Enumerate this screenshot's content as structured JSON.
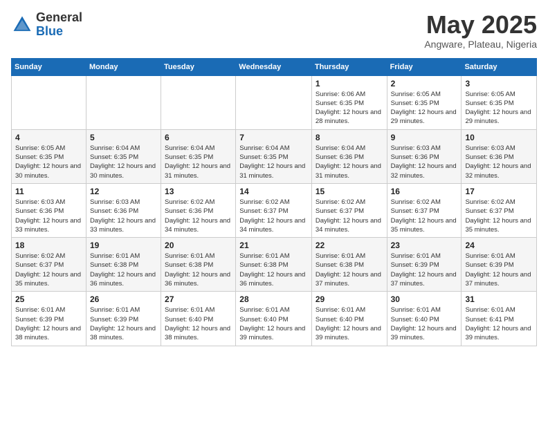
{
  "logo": {
    "general": "General",
    "blue": "Blue"
  },
  "title": "May 2025",
  "location": "Angware, Plateau, Nigeria",
  "headers": [
    "Sunday",
    "Monday",
    "Tuesday",
    "Wednesday",
    "Thursday",
    "Friday",
    "Saturday"
  ],
  "weeks": [
    [
      {
        "day": "",
        "sunrise": "",
        "sunset": "",
        "daylight": ""
      },
      {
        "day": "",
        "sunrise": "",
        "sunset": "",
        "daylight": ""
      },
      {
        "day": "",
        "sunrise": "",
        "sunset": "",
        "daylight": ""
      },
      {
        "day": "",
        "sunrise": "",
        "sunset": "",
        "daylight": ""
      },
      {
        "day": "1",
        "sunrise": "Sunrise: 6:06 AM",
        "sunset": "Sunset: 6:35 PM",
        "daylight": "Daylight: 12 hours and 28 minutes."
      },
      {
        "day": "2",
        "sunrise": "Sunrise: 6:05 AM",
        "sunset": "Sunset: 6:35 PM",
        "daylight": "Daylight: 12 hours and 29 minutes."
      },
      {
        "day": "3",
        "sunrise": "Sunrise: 6:05 AM",
        "sunset": "Sunset: 6:35 PM",
        "daylight": "Daylight: 12 hours and 29 minutes."
      }
    ],
    [
      {
        "day": "4",
        "sunrise": "Sunrise: 6:05 AM",
        "sunset": "Sunset: 6:35 PM",
        "daylight": "Daylight: 12 hours and 30 minutes."
      },
      {
        "day": "5",
        "sunrise": "Sunrise: 6:04 AM",
        "sunset": "Sunset: 6:35 PM",
        "daylight": "Daylight: 12 hours and 30 minutes."
      },
      {
        "day": "6",
        "sunrise": "Sunrise: 6:04 AM",
        "sunset": "Sunset: 6:35 PM",
        "daylight": "Daylight: 12 hours and 31 minutes."
      },
      {
        "day": "7",
        "sunrise": "Sunrise: 6:04 AM",
        "sunset": "Sunset: 6:35 PM",
        "daylight": "Daylight: 12 hours and 31 minutes."
      },
      {
        "day": "8",
        "sunrise": "Sunrise: 6:04 AM",
        "sunset": "Sunset: 6:36 PM",
        "daylight": "Daylight: 12 hours and 31 minutes."
      },
      {
        "day": "9",
        "sunrise": "Sunrise: 6:03 AM",
        "sunset": "Sunset: 6:36 PM",
        "daylight": "Daylight: 12 hours and 32 minutes."
      },
      {
        "day": "10",
        "sunrise": "Sunrise: 6:03 AM",
        "sunset": "Sunset: 6:36 PM",
        "daylight": "Daylight: 12 hours and 32 minutes."
      }
    ],
    [
      {
        "day": "11",
        "sunrise": "Sunrise: 6:03 AM",
        "sunset": "Sunset: 6:36 PM",
        "daylight": "Daylight: 12 hours and 33 minutes."
      },
      {
        "day": "12",
        "sunrise": "Sunrise: 6:03 AM",
        "sunset": "Sunset: 6:36 PM",
        "daylight": "Daylight: 12 hours and 33 minutes."
      },
      {
        "day": "13",
        "sunrise": "Sunrise: 6:02 AM",
        "sunset": "Sunset: 6:36 PM",
        "daylight": "Daylight: 12 hours and 34 minutes."
      },
      {
        "day": "14",
        "sunrise": "Sunrise: 6:02 AM",
        "sunset": "Sunset: 6:37 PM",
        "daylight": "Daylight: 12 hours and 34 minutes."
      },
      {
        "day": "15",
        "sunrise": "Sunrise: 6:02 AM",
        "sunset": "Sunset: 6:37 PM",
        "daylight": "Daylight: 12 hours and 34 minutes."
      },
      {
        "day": "16",
        "sunrise": "Sunrise: 6:02 AM",
        "sunset": "Sunset: 6:37 PM",
        "daylight": "Daylight: 12 hours and 35 minutes."
      },
      {
        "day": "17",
        "sunrise": "Sunrise: 6:02 AM",
        "sunset": "Sunset: 6:37 PM",
        "daylight": "Daylight: 12 hours and 35 minutes."
      }
    ],
    [
      {
        "day": "18",
        "sunrise": "Sunrise: 6:02 AM",
        "sunset": "Sunset: 6:37 PM",
        "daylight": "Daylight: 12 hours and 35 minutes."
      },
      {
        "day": "19",
        "sunrise": "Sunrise: 6:01 AM",
        "sunset": "Sunset: 6:38 PM",
        "daylight": "Daylight: 12 hours and 36 minutes."
      },
      {
        "day": "20",
        "sunrise": "Sunrise: 6:01 AM",
        "sunset": "Sunset: 6:38 PM",
        "daylight": "Daylight: 12 hours and 36 minutes."
      },
      {
        "day": "21",
        "sunrise": "Sunrise: 6:01 AM",
        "sunset": "Sunset: 6:38 PM",
        "daylight": "Daylight: 12 hours and 36 minutes."
      },
      {
        "day": "22",
        "sunrise": "Sunrise: 6:01 AM",
        "sunset": "Sunset: 6:38 PM",
        "daylight": "Daylight: 12 hours and 37 minutes."
      },
      {
        "day": "23",
        "sunrise": "Sunrise: 6:01 AM",
        "sunset": "Sunset: 6:39 PM",
        "daylight": "Daylight: 12 hours and 37 minutes."
      },
      {
        "day": "24",
        "sunrise": "Sunrise: 6:01 AM",
        "sunset": "Sunset: 6:39 PM",
        "daylight": "Daylight: 12 hours and 37 minutes."
      }
    ],
    [
      {
        "day": "25",
        "sunrise": "Sunrise: 6:01 AM",
        "sunset": "Sunset: 6:39 PM",
        "daylight": "Daylight: 12 hours and 38 minutes."
      },
      {
        "day": "26",
        "sunrise": "Sunrise: 6:01 AM",
        "sunset": "Sunset: 6:39 PM",
        "daylight": "Daylight: 12 hours and 38 minutes."
      },
      {
        "day": "27",
        "sunrise": "Sunrise: 6:01 AM",
        "sunset": "Sunset: 6:40 PM",
        "daylight": "Daylight: 12 hours and 38 minutes."
      },
      {
        "day": "28",
        "sunrise": "Sunrise: 6:01 AM",
        "sunset": "Sunset: 6:40 PM",
        "daylight": "Daylight: 12 hours and 39 minutes."
      },
      {
        "day": "29",
        "sunrise": "Sunrise: 6:01 AM",
        "sunset": "Sunset: 6:40 PM",
        "daylight": "Daylight: 12 hours and 39 minutes."
      },
      {
        "day": "30",
        "sunrise": "Sunrise: 6:01 AM",
        "sunset": "Sunset: 6:40 PM",
        "daylight": "Daylight: 12 hours and 39 minutes."
      },
      {
        "day": "31",
        "sunrise": "Sunrise: 6:01 AM",
        "sunset": "Sunset: 6:41 PM",
        "daylight": "Daylight: 12 hours and 39 minutes."
      }
    ]
  ]
}
